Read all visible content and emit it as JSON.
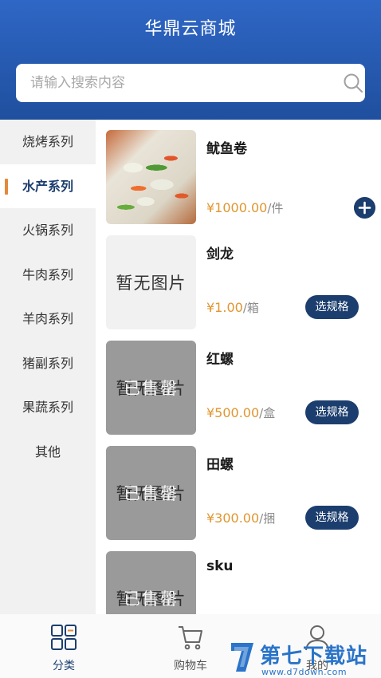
{
  "header": {
    "title": "华鼎云商城"
  },
  "search": {
    "placeholder": "请输入搜索内容"
  },
  "sidebar": {
    "items": [
      {
        "label": "烧烤系列",
        "active": false
      },
      {
        "label": "水产系列",
        "active": true
      },
      {
        "label": "火锅系列",
        "active": false
      },
      {
        "label": "牛肉系列",
        "active": false
      },
      {
        "label": "羊肉系列",
        "active": false
      },
      {
        "label": "猪副系列",
        "active": false
      },
      {
        "label": "果蔬系列",
        "active": false
      },
      {
        "label": "其他",
        "active": false
      }
    ]
  },
  "products": [
    {
      "name": "鱿鱼卷",
      "price": "¥1000.00",
      "unit": "/件",
      "image": "photo",
      "action": "add-icon"
    },
    {
      "name": "剑龙",
      "price": "¥1.00",
      "unit": "/箱",
      "image_text": "暂无图片",
      "action_label": "选规格"
    },
    {
      "name": "红螺",
      "price": "¥500.00",
      "unit": "/盒",
      "image_text": "暂无图片",
      "overlay_text": "已售罄",
      "action_label": "选规格"
    },
    {
      "name": "田螺",
      "price": "¥300.00",
      "unit": "/捆",
      "image_text": "暂无图片",
      "overlay_text": "已售罄",
      "action_label": "选规格"
    },
    {
      "name": "sku",
      "image_text": "暂无图片",
      "overlay_text": "已售罄"
    }
  ],
  "tabbar": {
    "items": [
      {
        "label": "分类",
        "icon": "category-grid-icon",
        "active": true
      },
      {
        "label": "购物车",
        "icon": "shopping-cart-icon",
        "active": false
      },
      {
        "label": "我的",
        "icon": "user-icon",
        "active": false
      }
    ]
  },
  "watermark": {
    "main": "第七下载站",
    "sub": "www.d7down.com"
  },
  "colors": {
    "primary": "#1c3e6e",
    "header": "#2f67c6",
    "price": "#e0962f",
    "accent_bar": "#e3893c"
  }
}
